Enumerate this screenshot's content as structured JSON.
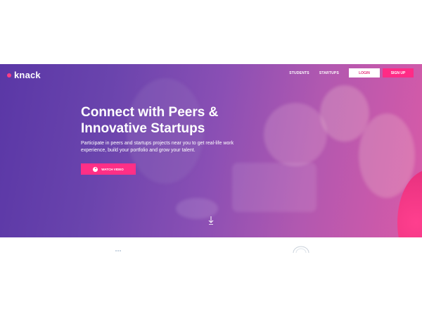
{
  "brand": {
    "name": "knack",
    "accent": "#ff2b86"
  },
  "nav": {
    "links": [
      "STUDENTS",
      "STARTUPS"
    ],
    "login_label": "LOGIN",
    "signup_label": "SIGN UP"
  },
  "hero": {
    "headline": "Connect with Peers & Innovative Startups",
    "subtext": "Participate in peers and startups projects near you to get real-life work experience, build your portfolio and grow your talent.",
    "cta_label": "WATCH VIDEO",
    "gradient_start": "#5a37a6",
    "gradient_end": "#d95aa7"
  },
  "icons": {
    "play": "play-icon",
    "scroll": "scroll-down-icon"
  }
}
